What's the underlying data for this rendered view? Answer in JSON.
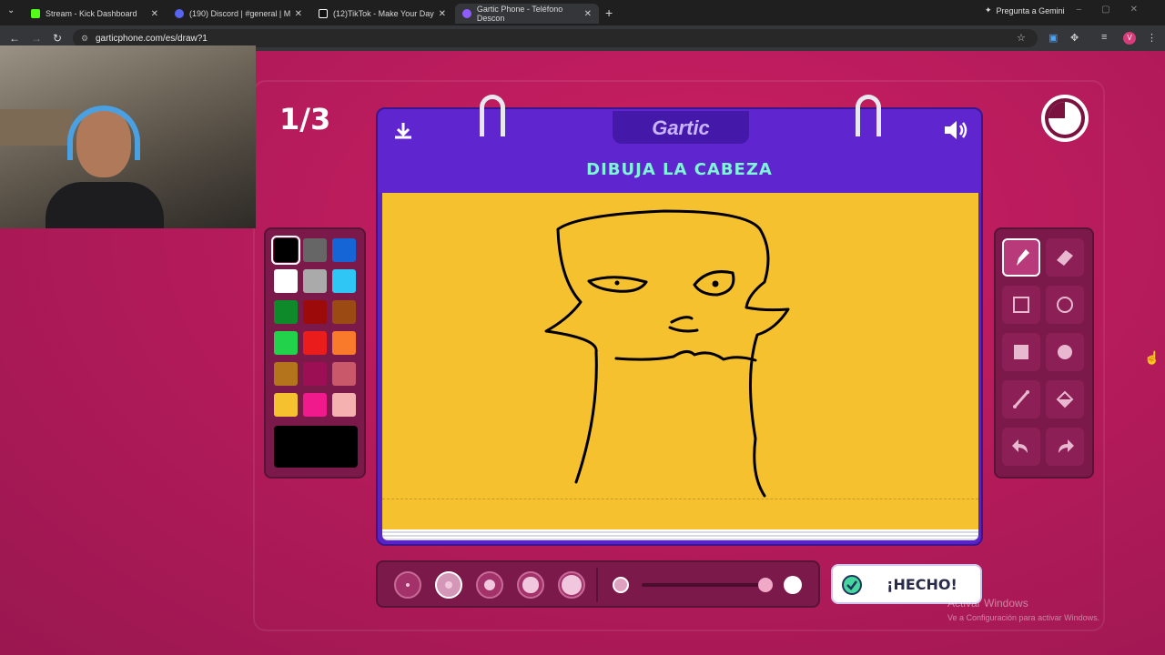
{
  "browser": {
    "tabs": [
      {
        "title": "Stream - Kick Dashboard",
        "color": "#53fc18"
      },
      {
        "title": "(190) Discord | #general | M",
        "color": "#5865f2"
      },
      {
        "title": "(12)TikTok - Make Your Day",
        "color": "#111111"
      },
      {
        "title": "Gartic Phone - Teléfono Descon",
        "color": "#8f5cff"
      }
    ],
    "new_tab": "+",
    "gemini_label": "Pregunta a Gemini",
    "url": "garticphone.com/es/draw?1",
    "profile_initial": "V"
  },
  "game": {
    "round_counter": "1/3",
    "logo": "Gartic",
    "prompt": "DIBUJA LA CABEZA",
    "done_label": "¡HECHO!",
    "selected_color": "#000000",
    "palette": [
      "#000000",
      "#666666",
      "#1565d6",
      "#ffffff",
      "#aaaaaa",
      "#2fc6f5",
      "#0f8a2a",
      "#9c0a0a",
      "#9a4a12",
      "#21d24a",
      "#ea1c1c",
      "#f97a2a",
      "#b3741c",
      "#9c0f55",
      "#c8586a",
      "#f5c12e",
      "#f01a8c",
      "#f5b0b0"
    ],
    "tools": [
      "pencil-icon",
      "eraser-icon",
      "rectangle-icon",
      "ellipse-icon",
      "filled-rectangle-icon",
      "filled-ellipse-icon",
      "line-icon",
      "fill-bucket-icon",
      "undo-icon",
      "redo-icon"
    ],
    "selected_tool": "pencil-icon",
    "brush_sizes": 5,
    "selected_size": 2,
    "canvas_color": "#f5c12e"
  },
  "system": {
    "watermark_title": "Activar Windows",
    "watermark_sub": "Ve a Configuración para activar Windows."
  }
}
